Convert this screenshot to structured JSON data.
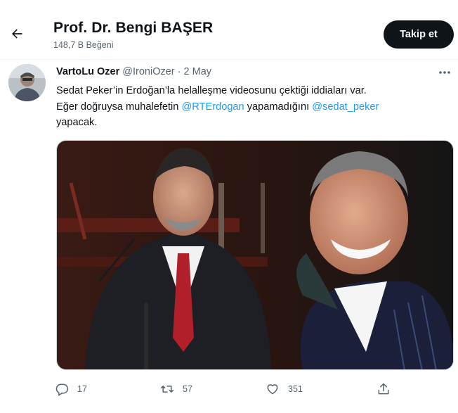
{
  "header": {
    "profile_name": "Prof. Dr. Bengi BAŞER",
    "likes_count": "148,7 B Beğeni",
    "follow_label": "Takip et"
  },
  "tweet": {
    "author_name": "VartoLu Ozer",
    "author_handle": "@IroniOzer",
    "separator": "·",
    "date": "2 May",
    "text_line1": "Sedat Peker’in Erdoğan’la helalleşme videosunu çektiği iddiaları var.",
    "text_line2_part1": "Eğer doğruysa muhalefetin ",
    "mention1": "@RTErdogan",
    "text_line2_part2": " yapamadığını ",
    "mention2": "@sedat_peker",
    "text_line3": "yapacak.",
    "reply_count": "17",
    "retweet_count": "57",
    "like_count": "351"
  },
  "icons": {
    "back": "back-arrow-icon",
    "more": "more-dots-icon",
    "reply": "reply-icon",
    "retweet": "retweet-icon",
    "like": "heart-icon",
    "share": "share-icon"
  },
  "colors": {
    "text": "#0f1419",
    "secondary": "#536471",
    "link": "#1d9bf0",
    "follow_button": "#0f1419"
  }
}
